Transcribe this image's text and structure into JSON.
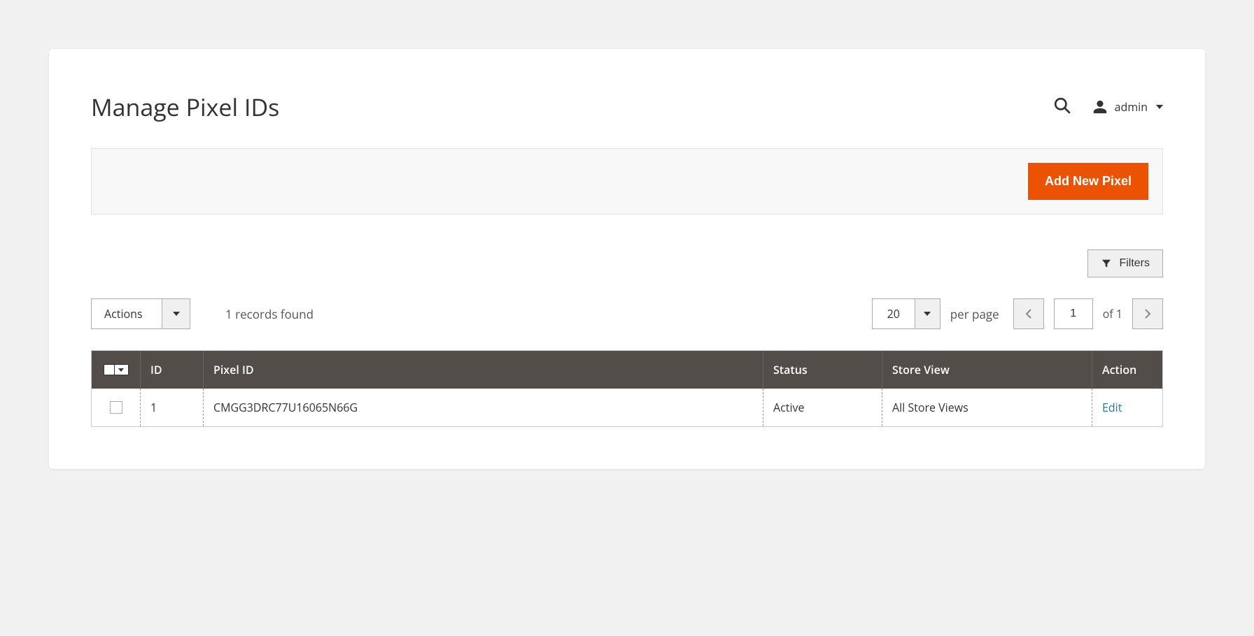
{
  "header": {
    "title": "Manage Pixel IDs",
    "admin_name": "admin"
  },
  "actionbar": {
    "add_button": "Add New Pixel"
  },
  "filters": {
    "button_label": "Filters"
  },
  "toolbar": {
    "actions_label": "Actions",
    "records_found": "1 records found",
    "per_page_value": "20",
    "per_page_label": "per page",
    "page_current": "1",
    "page_total": "of 1"
  },
  "grid": {
    "headers": {
      "id": "ID",
      "pixel_id": "Pixel ID",
      "status": "Status",
      "store_view": "Store View",
      "action": "Action"
    },
    "rows": [
      {
        "id": "1",
        "pixel_id": "CMGG3DRC77U16065N66G",
        "status": "Active",
        "store_view": "All Store Views",
        "action": "Edit"
      }
    ]
  }
}
